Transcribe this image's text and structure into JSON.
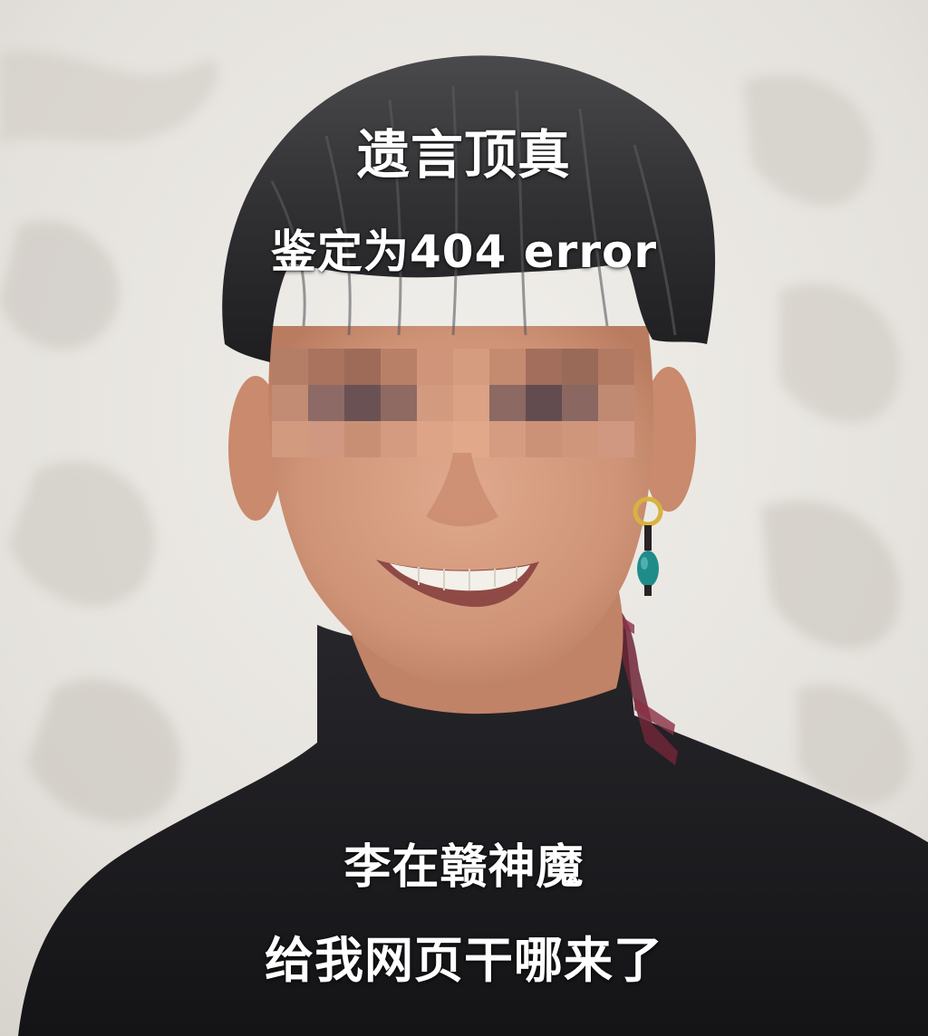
{
  "captions": {
    "line1": "遗言顶真",
    "line2": "鉴定为404 error",
    "line3": "李在赣神魔",
    "line4": "给我网页干哪来了"
  },
  "colors": {
    "caption_text": "#ffffff",
    "wall": "#e9e6e1",
    "hair": "#2a2a2c",
    "skin": "#d39a7e",
    "turtleneck": "#1f1e21",
    "collar_stripe": "#7a2a3c"
  },
  "photo": {
    "censor": "pixelated eye bar",
    "accessory": "gold hoop earring with turquoise bead"
  }
}
